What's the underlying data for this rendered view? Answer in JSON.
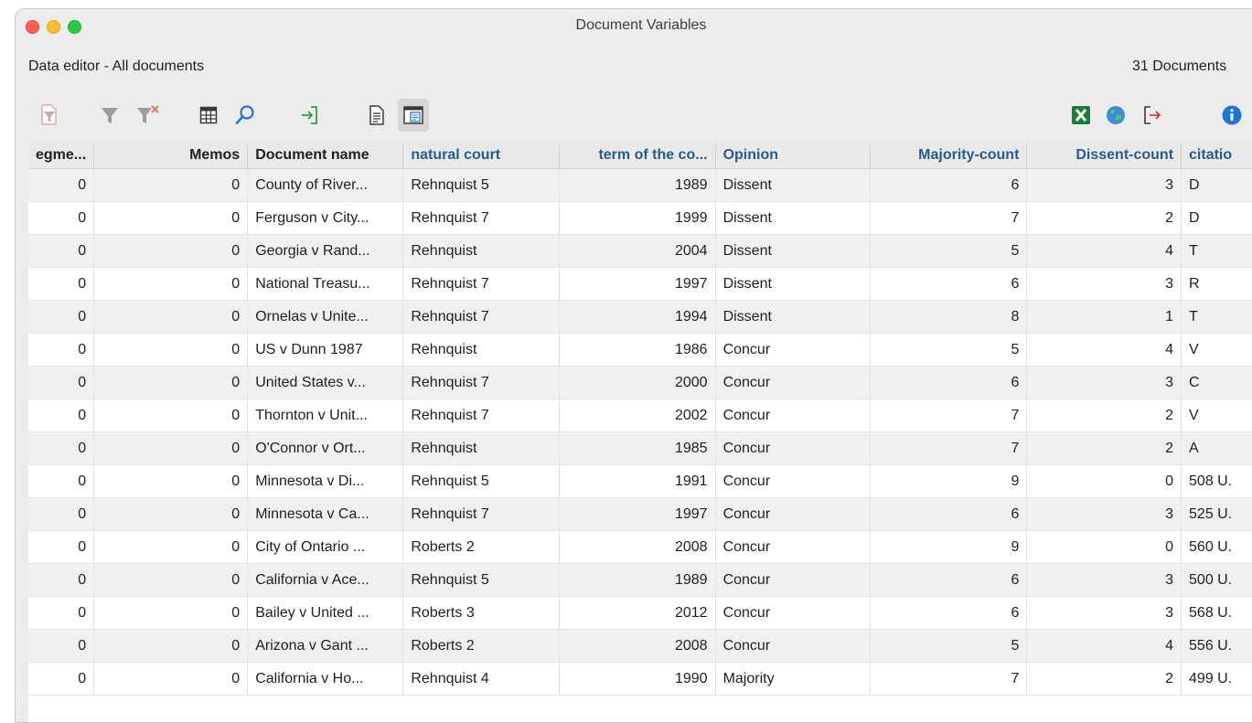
{
  "window": {
    "title": "Document Variables"
  },
  "info": {
    "left": "Data editor - All documents",
    "right": "31 Documents"
  },
  "toolbar": {
    "icons": [
      "filter-document-icon",
      "filter-icon",
      "clear-filter-icon",
      "columns-icon",
      "search-icon",
      "import-icon",
      "document-list-icon",
      "document-view-icon",
      "excel-icon",
      "web-export-icon",
      "export-icon",
      "info-icon"
    ],
    "colors": {
      "green": "#2f9e44",
      "blue": "#1f74d8",
      "red": "#d0453b",
      "excel": "#1d7a3a"
    }
  },
  "table": {
    "columns": [
      "egme...",
      "Memos",
      "Document name",
      "natural court",
      "term of the co...",
      "Opinion",
      "Majority-count",
      "Dissent-count",
      "citatio"
    ],
    "rows": [
      [
        "0",
        "0",
        "County of River...",
        "Rehnquist 5",
        "1989",
        "Dissent",
        "6",
        "3",
        "D"
      ],
      [
        "0",
        "0",
        "Ferguson v City...",
        "Rehnquist 7",
        "1999",
        "Dissent",
        "7",
        "2",
        "D"
      ],
      [
        "0",
        "0",
        "Georgia v Rand...",
        "Rehnquist",
        "2004",
        "Dissent",
        "5",
        "4",
        "T"
      ],
      [
        "0",
        "0",
        "National Treasu...",
        "Rehnquist 7",
        "1997",
        "Dissent",
        "6",
        "3",
        "R"
      ],
      [
        "0",
        "0",
        "Ornelas v Unite...",
        "Rehnquist 7",
        "1994",
        "Dissent",
        "8",
        "1",
        "T"
      ],
      [
        "0",
        "0",
        "US v Dunn 1987",
        "Rehnquist",
        "1986",
        "Concur",
        "5",
        "4",
        "V"
      ],
      [
        "0",
        "0",
        "United States v...",
        "Rehnquist 7",
        "2000",
        "Concur",
        "6",
        "3",
        "C"
      ],
      [
        "0",
        "0",
        "Thornton v Unit...",
        "Rehnquist 7",
        "2002",
        "Concur",
        "7",
        "2",
        "V"
      ],
      [
        "0",
        "0",
        "O'Connor v Ort...",
        "Rehnquist",
        "1985",
        "Concur",
        "7",
        "2",
        "A"
      ],
      [
        "0",
        "0",
        "Minnesota v Di...",
        "Rehnquist 5",
        "1991",
        "Concur",
        "9",
        "0",
        "508 U."
      ],
      [
        "0",
        "0",
        "Minnesota v Ca...",
        "Rehnquist 7",
        "1997",
        "Concur",
        "6",
        "3",
        "525 U."
      ],
      [
        "0",
        "0",
        "City of Ontario ...",
        "Roberts 2",
        "2008",
        "Concur",
        "9",
        "0",
        "560 U."
      ],
      [
        "0",
        "0",
        "California v Ace...",
        "Rehnquist 5",
        "1989",
        "Concur",
        "6",
        "3",
        "500 U."
      ],
      [
        "0",
        "0",
        "Bailey v United ...",
        "Roberts 3",
        "2012",
        "Concur",
        "6",
        "3",
        "568 U."
      ],
      [
        "0",
        "0",
        "Arizona v Gant ...",
        "Roberts 2",
        "2008",
        "Concur",
        "5",
        "4",
        "556 U."
      ],
      [
        "0",
        "0",
        "California v Ho...",
        "Rehnquist 4",
        "1990",
        "Majority",
        "7",
        "2",
        "499 U."
      ]
    ]
  }
}
